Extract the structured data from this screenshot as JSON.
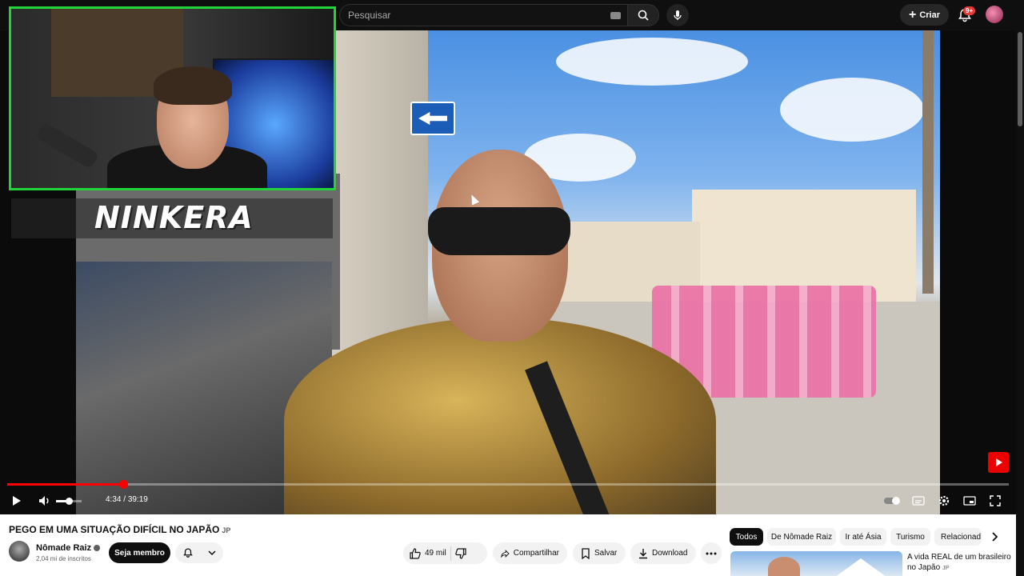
{
  "masthead": {
    "search_placeholder": "Pesquisar",
    "create_label": "Criar",
    "notifications_badge": "9+"
  },
  "player": {
    "overlay_logo": "NINKERA",
    "time_current": "4:34",
    "time_separator": " / ",
    "time_total": "39:19",
    "progress_fraction": 0.116,
    "volume_fraction": 0.5,
    "accent": "#ff0000",
    "webcam_border": "#22d33a"
  },
  "video": {
    "title": "PEGO EM UMA SITUAÇÃO DIFÍCIL NO JAPÃO",
    "title_suffix": "JP"
  },
  "channel": {
    "name": "Nômade Raiz",
    "subscribers": "2,04 mi de inscritos",
    "member_label": "Seja membro"
  },
  "actions": {
    "likes": "49 mil",
    "share_label": "Compartilhar",
    "save_label": "Salvar",
    "download_label": "Download"
  },
  "chips": [
    "Todos",
    "De Nômade Raiz",
    "Ir até Ásia",
    "Turismo",
    "Relacionad"
  ],
  "recommendation": {
    "title": "A vida REAL de um brasileiro no Japão",
    "suffix": "JP"
  }
}
